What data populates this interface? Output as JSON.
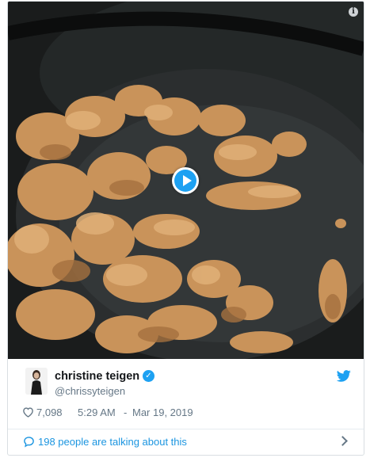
{
  "tweet": {
    "author": {
      "name": "christine teigen",
      "handle": "@chrissyteigen",
      "verified": true
    },
    "media": {
      "type": "video",
      "overlay_icon": "play-icon"
    },
    "info_icon": "info-icon",
    "info_glyph": "i",
    "likes": "7,098",
    "time": "5:29 AM",
    "separator": "-",
    "date": "Mar 19, 2019",
    "conversation_label": "198 people are talking about this"
  },
  "icons": {
    "like": "heart-icon",
    "conversation": "speech-bubble-icon",
    "brand": "twitter-bird-icon",
    "verified": "verified-badge-icon",
    "more": "chevron-right-icon"
  },
  "colors": {
    "accent": "#1da1f2",
    "link": "#1b95e0",
    "muted": "#657786",
    "text": "#14171a"
  }
}
